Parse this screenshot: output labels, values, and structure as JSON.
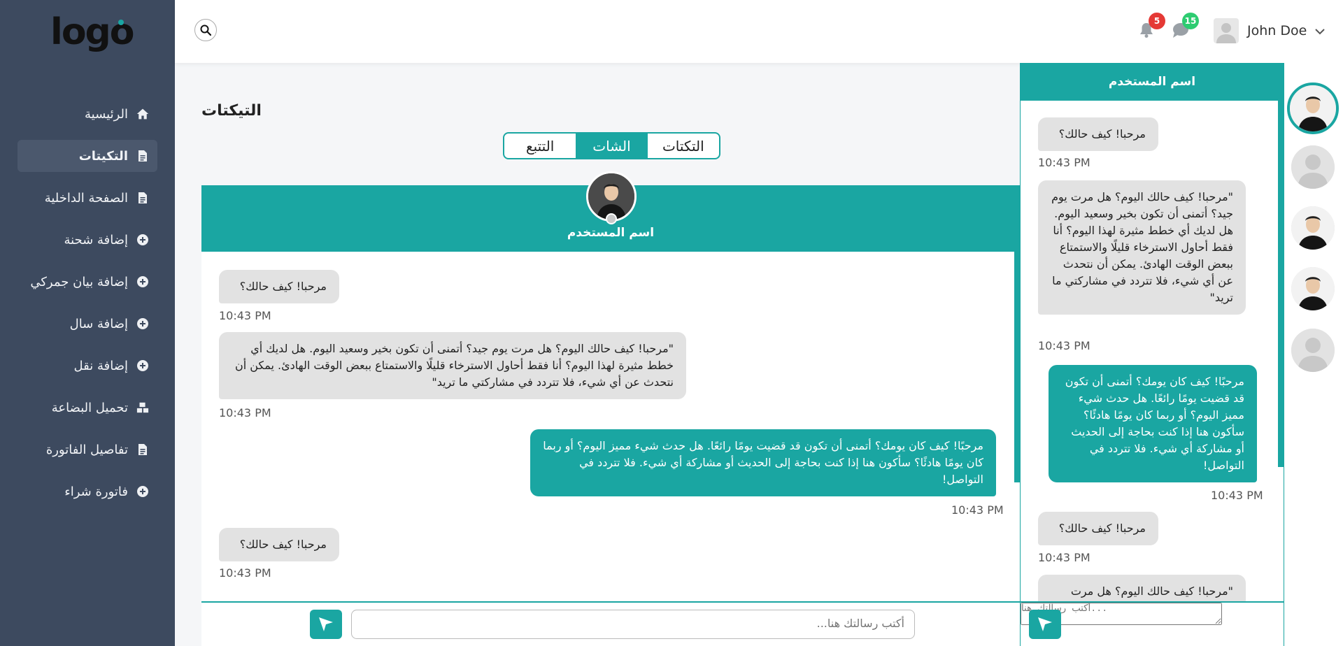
{
  "app": {
    "logo": "logo"
  },
  "sidebar": {
    "items": [
      {
        "label": "الرئيسية",
        "icon": "home-icon"
      },
      {
        "label": "التكيتات",
        "icon": "file-icon",
        "active": true
      },
      {
        "label": "الصفحة الداخلية",
        "icon": "file-icon"
      },
      {
        "label": "إضافة شحنة",
        "icon": "plus-circle-icon"
      },
      {
        "label": "إضافة بيان جمركي",
        "icon": "plus-circle-icon"
      },
      {
        "label": "إضافة سال",
        "icon": "plus-circle-icon"
      },
      {
        "label": "إضافة نقل",
        "icon": "plus-circle-icon"
      },
      {
        "label": "تحميل البضاعة",
        "icon": "boxes-icon"
      },
      {
        "label": "تفاصيل الفاتورة",
        "icon": "file-icon"
      },
      {
        "label": "فاتورة شراء",
        "icon": "plus-circle-icon"
      }
    ]
  },
  "topbar": {
    "notifications_count": "5",
    "messages_count": "15",
    "user_name": "John Doe",
    "colors": {
      "notif_badge": "#e53935",
      "msg_badge": "#2ecc71"
    }
  },
  "page": {
    "title": "التيكتات",
    "tabs": [
      {
        "label": "التتبع"
      },
      {
        "label": "الشات",
        "active": true
      },
      {
        "label": "التكتات"
      }
    ]
  },
  "chat": {
    "header_name": "اسم المستخدم",
    "messages": [
      {
        "text": "مرحبا! كيف حالك؟",
        "time": "10:43 PM"
      },
      {
        "text": "\"مرحبا! كيف حالك اليوم؟ هل مرت يوم جيد؟ أتمنى أن تكون بخير وسعيد اليوم. هل لديك أي خطط مثيرة لهذا اليوم؟ أنا فقط أحاول الاسترخاء قليلًا والاستمتاع ببعض الوقت الهادئ. يمكن أن نتحدث عن أي شيء، فلا تتردد في مشاركتي ما تريد\"",
        "time": "10:43 PM"
      },
      {
        "text": "مرحبًا! كيف كان يومك؟ أتمنى أن تكون قد قضيت يومًا رائعًا. هل حدث شيء مميز اليوم؟ أو ربما كان يومًا هادئًا؟ سأكون هنا إذا كنت بحاجة إلى الحديث أو مشاركة أي شيء. فلا تتردد في التواصل!",
        "time": "10:43 PM"
      },
      {
        "text": "مرحبا! كيف حالك؟",
        "time": "10:43 PM"
      }
    ],
    "input_placeholder": "أكتب رسالتك هنا..."
  },
  "side_chat": {
    "header_name": "اسم المستخدم",
    "messages": [
      {
        "text": "مرحبا! كيف حالك؟",
        "time": "10:43 PM"
      },
      {
        "text": "\"مرحبا! كيف حالك اليوم؟ هل مرت يوم جيد؟ أتمنى أن تكون بخير وسعيد اليوم. هل لديك أي خطط مثيرة لهذا اليوم؟ أنا فقط أحاول الاسترخاء قليلًا والاستمتاع ببعض الوقت الهادئ. يمكن أن نتحدث عن أي شيء، فلا تتردد في مشاركتي ما تريد\"",
        "time": "10:43 PM"
      },
      {
        "text": "مرحبًا! كيف كان يومك؟ أتمنى أن تكون قد قضيت يومًا رائعًا. هل حدث شيء مميز اليوم؟ أو ربما كان يومًا هادئًا؟ سأكون هنا إذا كنت بحاجة إلى الحديث أو مشاركة أي شيء. فلا تتردد في التواصل!",
        "time": "10:43 PM"
      },
      {
        "text": "مرحبا! كيف حالك؟",
        "time": "10:43 PM"
      },
      {
        "text": "\"مرحبا! كيف حالك اليوم؟ هل مرت"
      }
    ],
    "input_placeholder": "أكتب رسالتك هنا..."
  },
  "theme": {
    "accent": "#1aa6a2",
    "sidebar_bg": "#3d4a5f"
  }
}
